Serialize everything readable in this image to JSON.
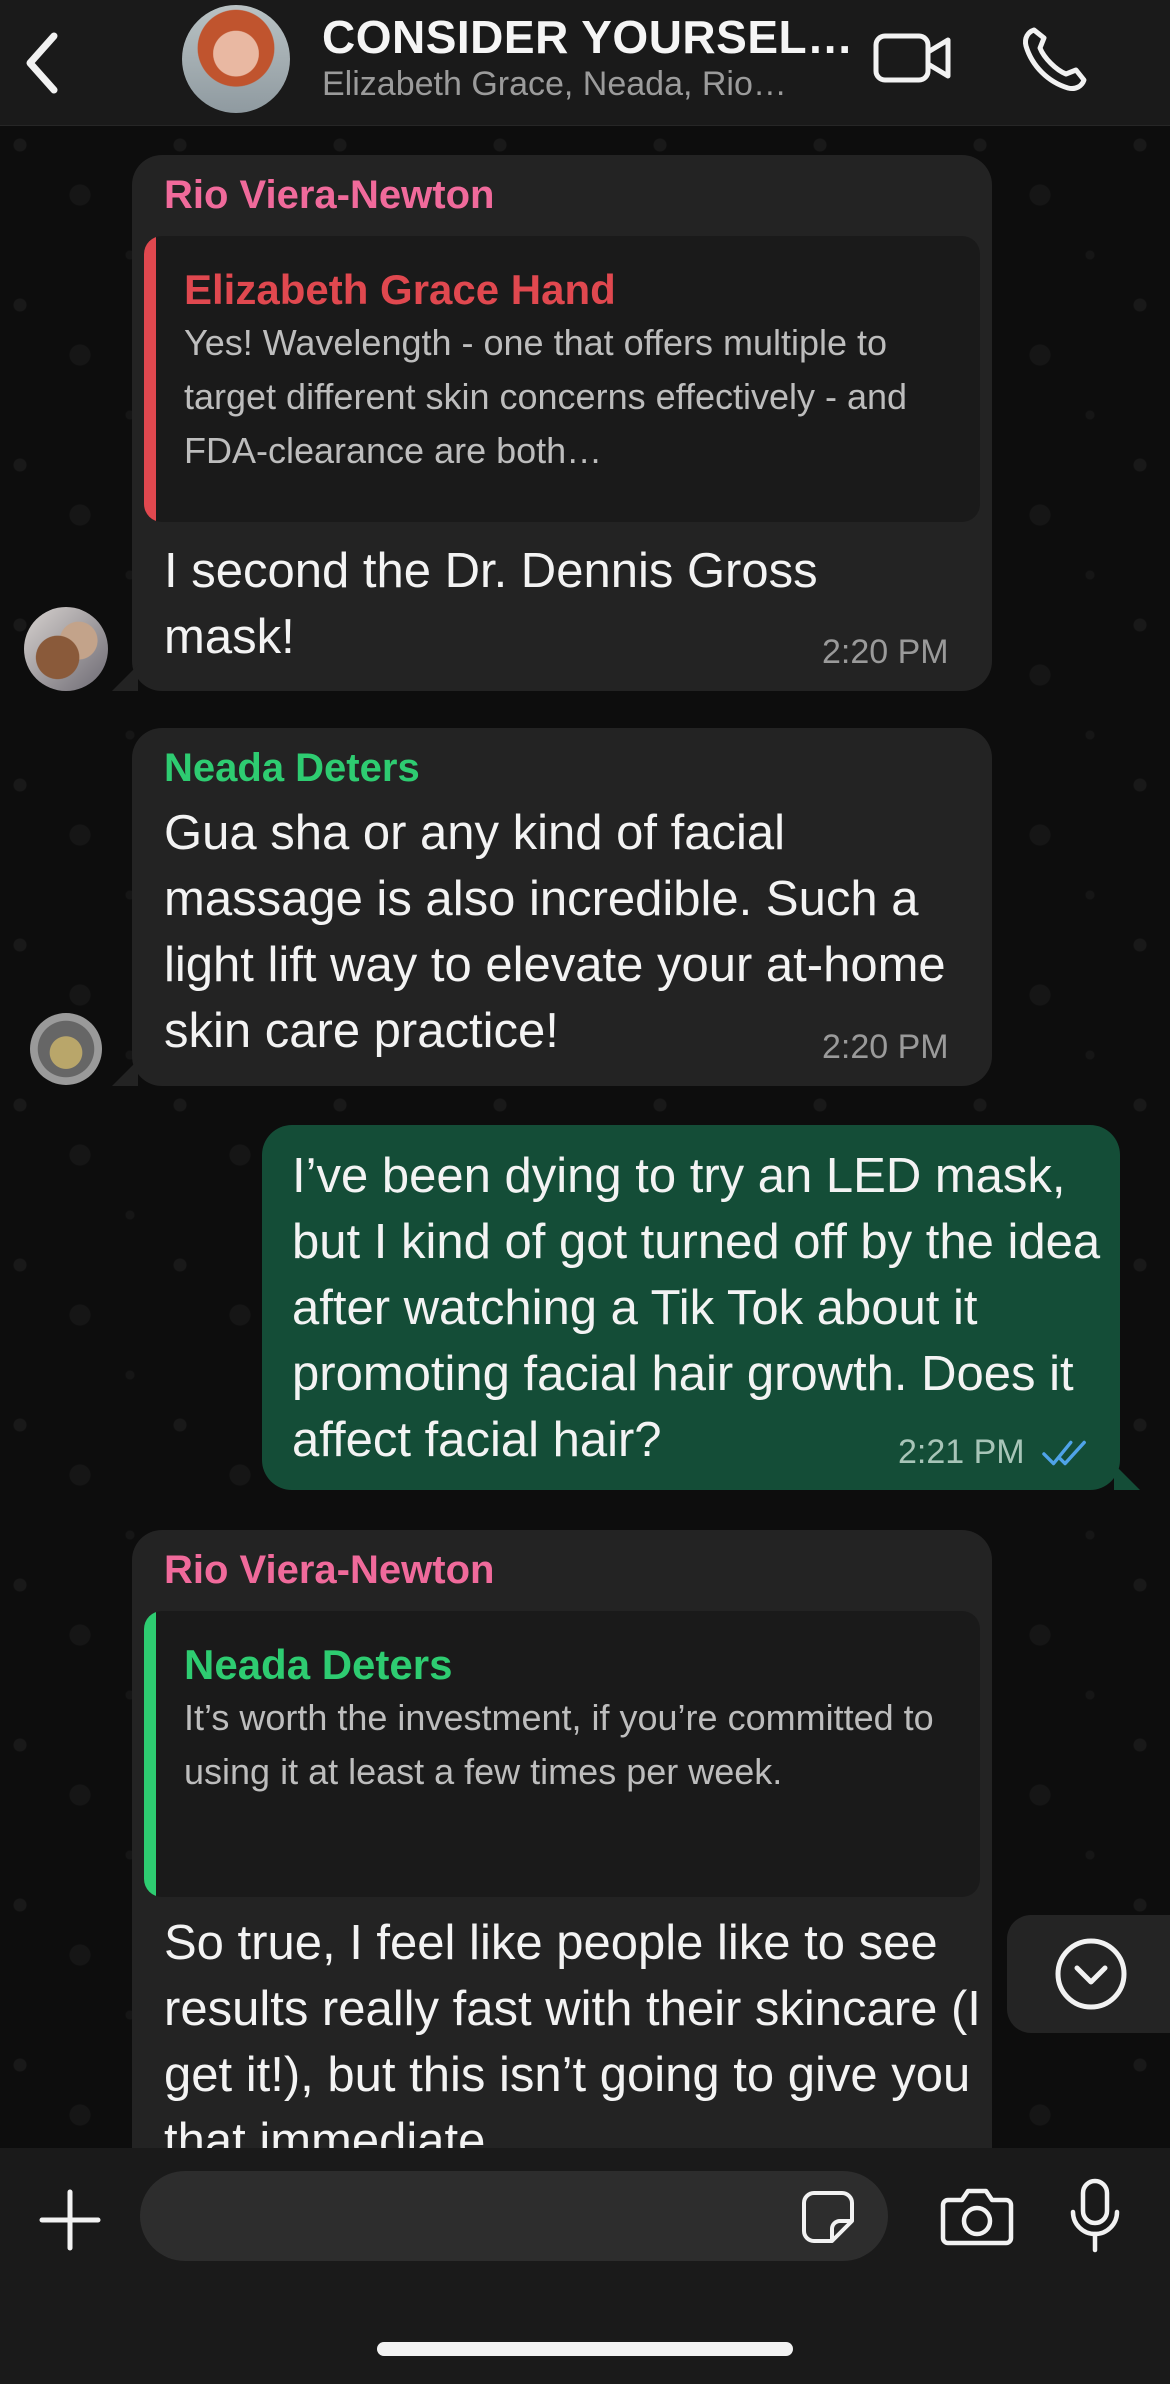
{
  "header": {
    "title": "CONSIDER YOURSEL…",
    "subtitle": "Elizabeth Grace, Neada, Rio…"
  },
  "messages": [
    {
      "sender": "Rio Viera-Newton",
      "sender_color": "#f06a9b",
      "quote": {
        "name": "Elizabeth Grace Hand",
        "name_color": "#e0484f",
        "bar_color": "#e0484f",
        "text": "Yes! Wavelength - one that offers multiple to target different skin concerns effectively - and FDA-clearance are both…"
      },
      "text": "I second the Dr. Dennis Gross mask!",
      "time": "2:20 PM"
    },
    {
      "sender": "Neada Deters",
      "sender_color": "#2ecc71",
      "text": "Gua sha or any kind of facial massage is also incredible. Such a light lift way to elevate your at-home skin care practice!",
      "time": "2:20 PM"
    },
    {
      "sender": "",
      "outgoing": true,
      "text": "I’ve been dying to try an LED mask, but I kind of got turned off by the idea after watching a Tik Tok about it promoting facial hair growth. Does it affect facial hair?",
      "time": "2:21 PM",
      "status": "read"
    },
    {
      "sender": "Rio Viera-Newton",
      "sender_color": "#f06a9b",
      "quote": {
        "name": "Neada Deters",
        "name_color": "#2ecc71",
        "bar_color": "#2ecc71",
        "text": "It’s worth the investment, if you’re committed to using it at least a few times per week."
      },
      "text": "So true, I feel like people like to see results really fast with their skincare (I get it!), but this isn’t going to give you that immediate"
    }
  ],
  "icons": {
    "back": "chevron-left-icon",
    "video": "video-camera-icon",
    "phone": "phone-icon",
    "scroll": "chevron-down-circle-icon",
    "plus": "plus-icon",
    "sticker": "sticker-icon",
    "camera": "camera-icon",
    "mic": "microphone-icon"
  },
  "colors": {
    "outgoing_bubble": "#144d37",
    "incoming_bubble": "#232323",
    "read_ticks": "#4fa3e8"
  }
}
